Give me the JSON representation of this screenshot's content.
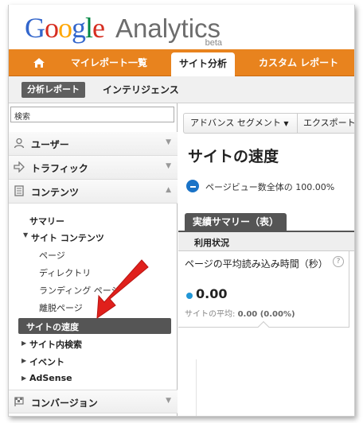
{
  "brand": {
    "logo_google": "Google",
    "logo_analytics": "Analytics",
    "beta": "beta"
  },
  "topnav": {
    "home_icon": "home-icon",
    "items": [
      "マイレポート一覧",
      "サイト分析",
      "カスタム レポート"
    ],
    "active": "サイト分析"
  },
  "subnav": {
    "reports": "分析レポート",
    "intelligence": "インテリジェンス"
  },
  "sidebar": {
    "search_value": "検索",
    "sections": [
      {
        "label": "ユーザー",
        "icon": "users-icon",
        "state": "collapsed"
      },
      {
        "label": "トラフィック",
        "icon": "traffic-arrow-icon",
        "state": "collapsed"
      },
      {
        "label": "コンテンツ",
        "icon": "content-icon",
        "state": "expanded"
      },
      {
        "label": "コンバージョン",
        "icon": "flag-icon",
        "state": "collapsed"
      }
    ],
    "content_items": {
      "summary": "サマリー",
      "site_content": "サイト コンテンツ",
      "page": "ページ",
      "directory": "ディレクトリ",
      "landing_page": "ランディング ページ",
      "exit_page": "離脱ページ",
      "site_speed": "サイトの速度",
      "site_search": "サイト内検索",
      "events": "イベント",
      "adsense": "AdSense"
    }
  },
  "main": {
    "segment_button": "アドバンス セグメント",
    "export_button": "エクスポート",
    "title": "サイトの速度",
    "percent_text": "ページビュー数全体の 100.00%",
    "summary_tab": "実績サマリー（表）",
    "usage_label": "利用状況",
    "metric": {
      "title": "ページの平均読み込み時間（秒）",
      "value": "0.00",
      "site_avg_label": "サイトの平均:",
      "site_avg_value": "0.00 (0.00%)",
      "help": "?"
    }
  },
  "colors": {
    "nav_orange": "#e8831e",
    "selected_gray": "#555555",
    "accent_blue": "#1a73c7",
    "arrow_red": "#e0201c"
  }
}
